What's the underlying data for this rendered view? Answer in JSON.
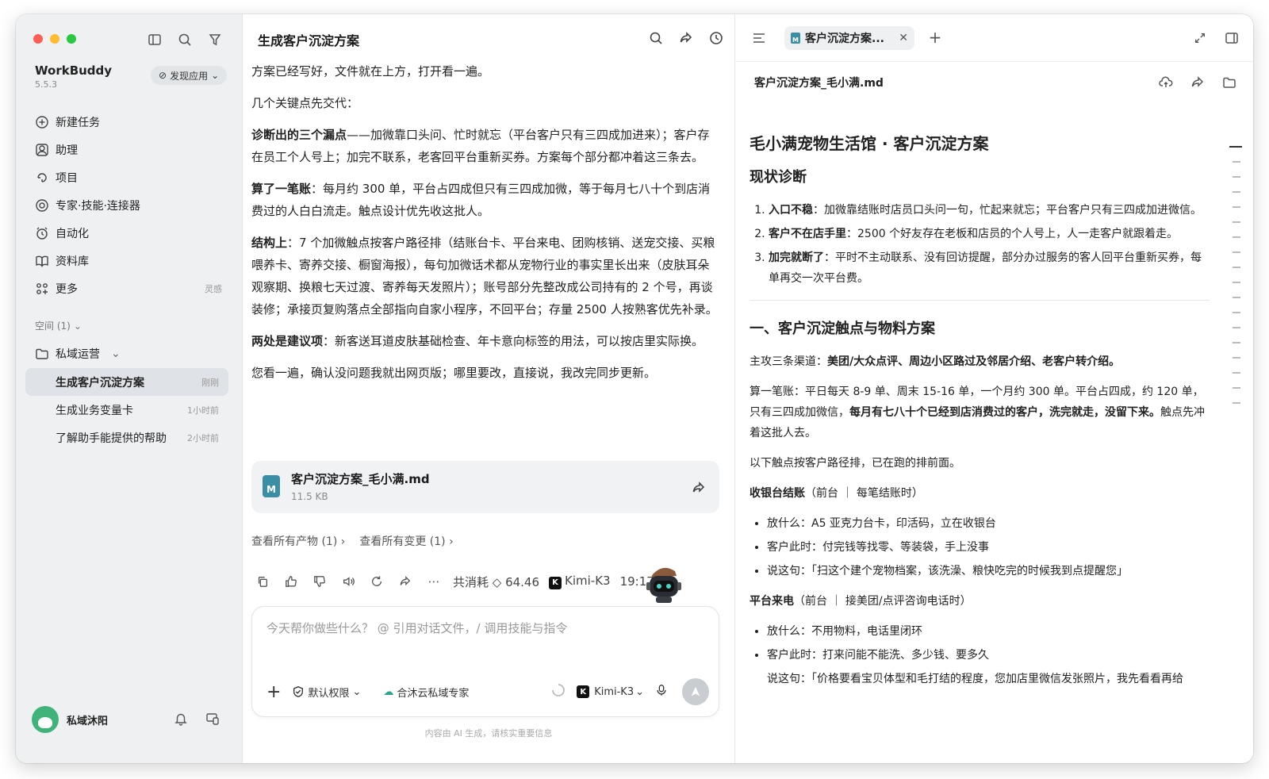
{
  "sidebar": {
    "brand_name": "WorkBuddy",
    "version": "5.5.3",
    "discover_label": "发现应用",
    "nav": [
      {
        "label": "新建任务",
        "icon": "plus-circle-icon",
        "extra": ""
      },
      {
        "label": "助理",
        "icon": "assistant-icon",
        "extra": ""
      },
      {
        "label": "项目",
        "icon": "project-icon",
        "extra": ""
      },
      {
        "label": "专家·技能·连接器",
        "icon": "expert-icon",
        "extra": ""
      },
      {
        "label": "自动化",
        "icon": "automation-icon",
        "extra": ""
      },
      {
        "label": "资料库",
        "icon": "book-icon",
        "extra": ""
      },
      {
        "label": "更多",
        "icon": "more-grid-icon",
        "extra": "灵感"
      }
    ],
    "space_label": "空间 (1)",
    "folder_label": "私域运营",
    "tasks": [
      {
        "label": "生成客户沉淀方案",
        "time": "刚刚"
      },
      {
        "label": "生成业务变量卡",
        "time": "1小时前"
      },
      {
        "label": "了解助手能提供的帮助",
        "time": "2小时前"
      }
    ],
    "user_name": "私域沐阳"
  },
  "chat": {
    "title": "生成客户沉淀方案",
    "p1": "方案已经写好，文件就在上方，打开看一遍。",
    "p2": "几个关键点先交代：",
    "p3_bold": "诊断出的三个漏点",
    "p3_text": "——加微靠口头问、忙时就忘（平台客户只有三四成加进来）；客户存在员工个人号上；加完不联系，老客回平台重新买券。方案每个部分都冲着这三条去。",
    "p4_bold": "算了一笔账",
    "p4_text": "：每月约 300 单，平台占四成但只有三四成加微，等于每月七八十个到店消费过的人白白流走。触点设计优先收这批人。",
    "p5_bold": "结构上",
    "p5_text": "：7 个加微触点按客户路径排（结账台卡、平台来电、团购核销、送宠交接、买粮喂养卡、寄养交接、橱窗海报），每句加微话术都从宠物行业的事实里长出来（皮肤耳朵观察期、换粮七天过渡、寄养每天发照片）；账号部分先整改成公司持有的 2 个号，再谈装修；承接页复购落点全部指向自家小程序，不回平台；存量 2500 人按熟客优先补录。",
    "p6_bold": "两处是建议项",
    "p6_text": "：新客送耳道皮肤基础检查、年卡意向标签的用法，可以按店里实际换。",
    "p7": "您看一遍，确认没问题我就出网页版；哪里要改，直接说，我改完同步更新。",
    "file_name": "客户沉淀方案_毛小满.md",
    "file_size": "11.5 KB",
    "link_artifacts": "查看所有产物 (1)",
    "link_changes": "查看所有变更 (1)",
    "consumption": "共消耗 ◇ 64.46",
    "model_name": "Kimi-K3",
    "time": "19:17",
    "composer_placeholder": "今天帮你做些什么？ @ 引用对话文件，/ 调用技能与指令",
    "permission_label": "默认权限",
    "expert_label": "合沐云私域专家",
    "model_select": "Kimi-K3",
    "disclaimer": "内容由 AI 生成，请核实重要信息"
  },
  "doc": {
    "tab_label": "客户沉淀方案...",
    "file_title": "客户沉淀方案_毛小满.md",
    "h1": "毛小满宠物生活馆 · 客户沉淀方案",
    "h2_status": "现状诊断",
    "diag": [
      {
        "bold": "入口不稳",
        "text": "：加微靠结账时店员口头问一句，忙起来就忘；平台客户只有三四成加进微信。"
      },
      {
        "bold": "客户不在店手里",
        "text": "：2500 个好友存在老板和店员的个人号上，人一走客户就跟着走。"
      },
      {
        "bold": "加完就断了",
        "text": "：平时不主动联系、没有回访提醒，部分办过服务的客人回平台重新买券，每单再交一次平台费。"
      }
    ],
    "h2_touch": "一、客户沉淀触点与物料方案",
    "channels_prefix": "主攻三条渠道：",
    "channels_bold": "美团/大众点评、周边小区路过及邻居介绍、老客户转介绍。",
    "calc_text": "算一笔账：平日每天 8-9 单、周末 15-16 单，一个月约 300 单。平台占四成，约 120 单，只有三四成加微信，",
    "calc_bold": "每月有七八十个已经到店消费过的客户，洗完就走，没留下来。",
    "calc_tail": "触点先冲着这批人去。",
    "order_text": "以下触点按客户路径排，已在跑的排前面。",
    "s1_title": "收银台结账",
    "s1_note": "（前台 ｜ 每笔结账时）",
    "s1_items": [
      "放什么：A5 亚克力台卡，印活码，立在收银台",
      "客户此时：付完钱等找零、等装袋，手上没事",
      "说这句：「扫这个建个宠物档案，该洗澡、粮快吃完的时候我到点提醒您」"
    ],
    "s2_title": "平台来电",
    "s2_note": "（前台 ｜ 接美团/点评咨询电话时）",
    "s2_items": [
      "放什么：不用物料，电话里闭环",
      "客户此时：打来问能不能洗、多少钱、要多久",
      "说这句：「价格要看宝贝体型和毛打结的程度，您加店里微信发张照片，我先看看再给"
    ]
  },
  "colors": {
    "traffic_red": "#ff5f57",
    "traffic_yellow": "#febc2e",
    "traffic_green": "#28c840",
    "markdown_icon": "#3a8fa7"
  }
}
